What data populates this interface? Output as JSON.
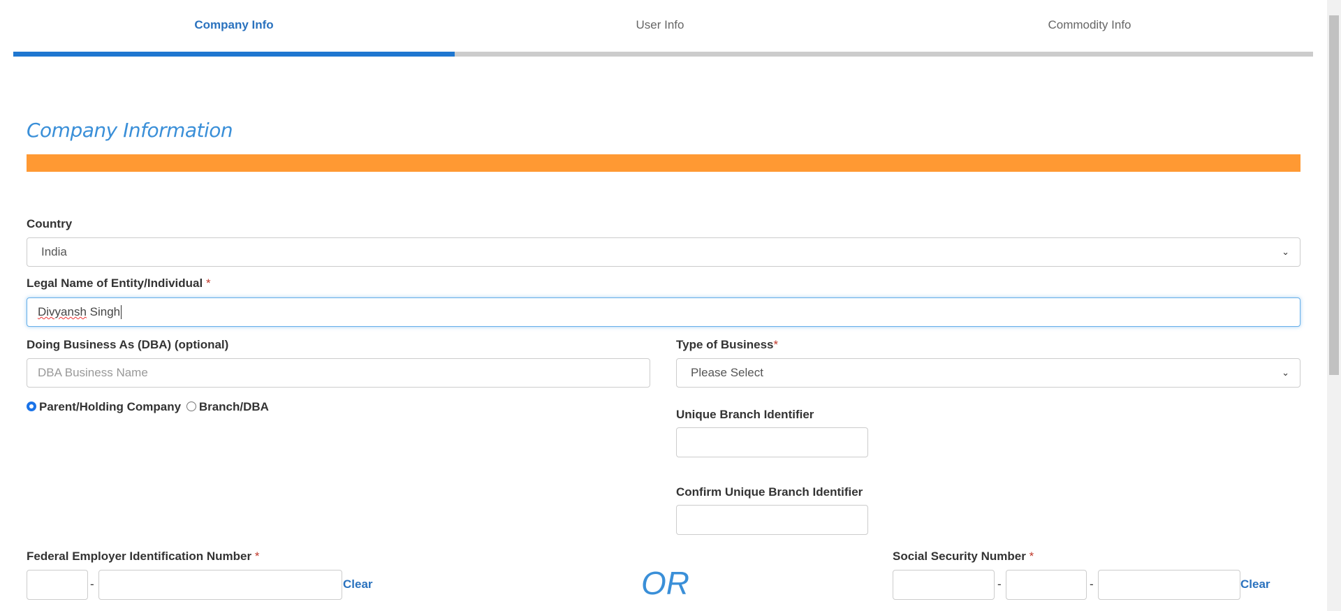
{
  "tabs": [
    {
      "label": "Company Info",
      "active": true
    },
    {
      "label": "User Info"
    },
    {
      "label": "Commodity Info"
    }
  ],
  "progress": {
    "step": 1,
    "total": 3,
    "active_color": "#1f77d0",
    "track_color": "#cccccc"
  },
  "section_title": "Company Information",
  "accent_color": "#ff9933",
  "form": {
    "country": {
      "label": "Country",
      "value": "India"
    },
    "legal_name": {
      "label": "Legal Name of Entity/Individual",
      "required": "*",
      "first": "Divyansh",
      "rest": " Singh"
    },
    "dba": {
      "label": "Doing Business As (DBA) (optional)",
      "placeholder": "DBA Business Name"
    },
    "type_of_business": {
      "label": "Type of Business",
      "required": "*",
      "value": "Please Select"
    },
    "company_type": {
      "options": [
        "Parent/Holding Company",
        "Branch/DBA"
      ],
      "selected": "Parent/Holding Company"
    },
    "unique_branch": {
      "label": "Unique Branch Identifier"
    },
    "confirm_branch": {
      "label": "Confirm Unique Branch Identifier"
    },
    "fein": {
      "label": "Federal Employer Identification Number",
      "required": "*",
      "separator": "-",
      "clear": "Clear"
    },
    "or": "OR",
    "ssn": {
      "label": "Social Security Number",
      "required": "*",
      "separator": "-",
      "clear": "Clear"
    }
  }
}
